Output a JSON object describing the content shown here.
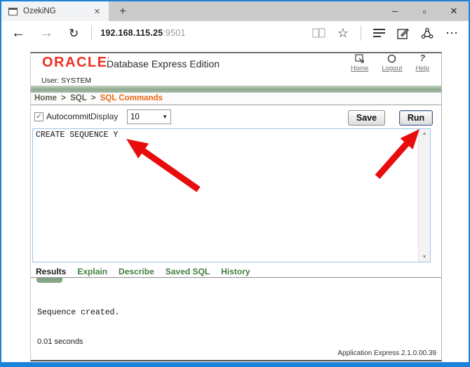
{
  "browser": {
    "tab_title": "OzekiNG",
    "tab_close": "✕",
    "new_tab": "+",
    "url_host": "192.168.115.25",
    "url_port": ":9501",
    "back": "←",
    "forward": "→",
    "refresh": "↻",
    "star": "☆",
    "more": "⋯",
    "minimize": "─",
    "maximize": "▫",
    "close": "✕"
  },
  "header": {
    "logo": "ORACLE",
    "product": "Database Express Edition",
    "user": "User: SYSTEM",
    "links": {
      "home": "Home",
      "logout": "Logout",
      "help": "Help"
    },
    "help_icon": "?"
  },
  "breadcrumb": {
    "home": "Home",
    "sql": "SQL",
    "current": "SQL Commands",
    "sep": ">"
  },
  "toolbar": {
    "autocommit": "Autocommit",
    "checkmark": "✓",
    "display": "Display",
    "display_value": "10",
    "dropdown_arrow": "▼",
    "save": "Save",
    "run": "Run"
  },
  "editor": {
    "sql": "CREATE SEQUENCE Y",
    "scroll_up": "▲",
    "scroll_down": "▼"
  },
  "result_tabs": {
    "results": "Results",
    "explain": "Explain",
    "describe": "Describe",
    "saved_sql": "Saved SQL",
    "history": "History"
  },
  "results": {
    "message": "Sequence created.",
    "elapsed": "0.01 seconds"
  },
  "footer": {
    "version": "Application Express 2.1.0.00.39"
  },
  "colors": {
    "window_blue": "#1c84d8",
    "oracle_red": "#ee3124",
    "arrow_red": "#e80c0c",
    "breadcrumb_orange": "#ee6611",
    "tab_green": "#417f41"
  }
}
